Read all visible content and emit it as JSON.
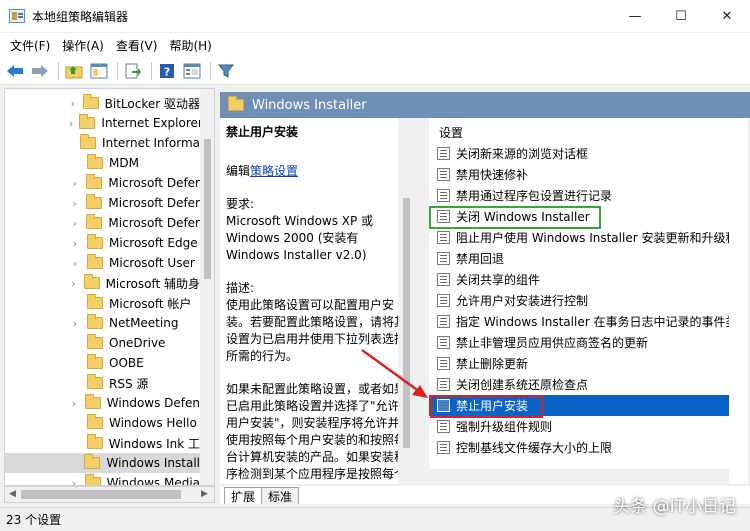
{
  "window": {
    "title": "本地组策略编辑器",
    "minimize": "—",
    "maximize": "☐",
    "close": "✕"
  },
  "menu": [
    "文件(F)",
    "操作(A)",
    "查看(V)",
    "帮助(H)"
  ],
  "tree": {
    "items": [
      {
        "label": "BitLocker 驱动器",
        "has_children": true,
        "selected": false
      },
      {
        "label": "Internet Explorer",
        "has_children": true,
        "selected": false
      },
      {
        "label": "Internet Informa",
        "has_children": false,
        "selected": false
      },
      {
        "label": "MDM",
        "has_children": false,
        "selected": false
      },
      {
        "label": "Microsoft Defer",
        "has_children": true,
        "selected": false
      },
      {
        "label": "Microsoft Defer",
        "has_children": true,
        "selected": false
      },
      {
        "label": "Microsoft Defer",
        "has_children": true,
        "selected": false
      },
      {
        "label": "Microsoft Edge",
        "has_children": true,
        "selected": false
      },
      {
        "label": "Microsoft User",
        "has_children": true,
        "selected": false
      },
      {
        "label": "Microsoft 辅助身",
        "has_children": true,
        "selected": false
      },
      {
        "label": "Microsoft 帐户",
        "has_children": false,
        "selected": false
      },
      {
        "label": "NetMeeting",
        "has_children": true,
        "selected": false
      },
      {
        "label": "OneDrive",
        "has_children": false,
        "selected": false
      },
      {
        "label": "OOBE",
        "has_children": false,
        "selected": false
      },
      {
        "label": "RSS 源",
        "has_children": false,
        "selected": false
      },
      {
        "label": "Windows Defen",
        "has_children": true,
        "selected": false
      },
      {
        "label": "Windows Hello",
        "has_children": false,
        "selected": false
      },
      {
        "label": "Windows Ink 工",
        "has_children": false,
        "selected": false
      },
      {
        "label": "Windows Install",
        "has_children": false,
        "selected": true
      },
      {
        "label": "Windows Media",
        "has_children": true,
        "selected": false
      }
    ]
  },
  "header": {
    "title": "Windows Installer"
  },
  "description": {
    "title": "禁止用户安装",
    "edit_prefix": "编辑",
    "edit_link": "策略设置",
    "requirements_label": "要求:",
    "requirements_text": "Microsoft Windows XP 或 Windows 2000 (安装有 Windows Installer v2.0)",
    "description_label": "描述:",
    "description_text": "使用此策略设置可以配置用户安装。若要配置此策略设置，请将其设置为已启用并使用下拉列表选择所需的行为。",
    "extra_text": "如果未配置此策略设置，或者如果已启用此策略设置并选择了\"允许用户安装\"，则安装程序将允许并使用按照每个用户安装的和按照每台计算机安装的产品。如果安装程序检测到某个应用程序是按照每个用户"
  },
  "settings": {
    "header": "设置",
    "items": [
      {
        "label": "关闭新来源的浏览对话框",
        "selected": false
      },
      {
        "label": "禁用快速修补",
        "selected": false
      },
      {
        "label": "禁用通过程序包设置进行记录",
        "selected": false
      },
      {
        "label": "关闭 Windows Installer",
        "selected": false
      },
      {
        "label": "阻止用户使用 Windows Installer 安装更新和升级程序",
        "selected": false
      },
      {
        "label": "禁用回退",
        "selected": false
      },
      {
        "label": "关闭共享的组件",
        "selected": false
      },
      {
        "label": "允许用户对安装进行控制",
        "selected": false
      },
      {
        "label": "指定 Windows Installer 在事务日志中记录的事件类型",
        "selected": false
      },
      {
        "label": "禁止非管理员应用供应商签名的更新",
        "selected": false
      },
      {
        "label": "禁止删除更新",
        "selected": false
      },
      {
        "label": "关闭创建系统还原检查点",
        "selected": false
      },
      {
        "label": "禁止用户安装",
        "selected": true
      },
      {
        "label": "强制升级组件规则",
        "selected": false
      },
      {
        "label": "控制基线文件缓存大小的上限",
        "selected": false
      }
    ]
  },
  "tabs": [
    "扩展",
    "标准"
  ],
  "status": "23 个设置",
  "watermark": "头条 @IT小日记",
  "colors": {
    "header_bg": "#6f8fb5",
    "selection_blue": "#0a64c8",
    "tree_selection": "#d9d9d9",
    "highlight_green": "#3aa33a",
    "highlight_red": "#e02020"
  }
}
